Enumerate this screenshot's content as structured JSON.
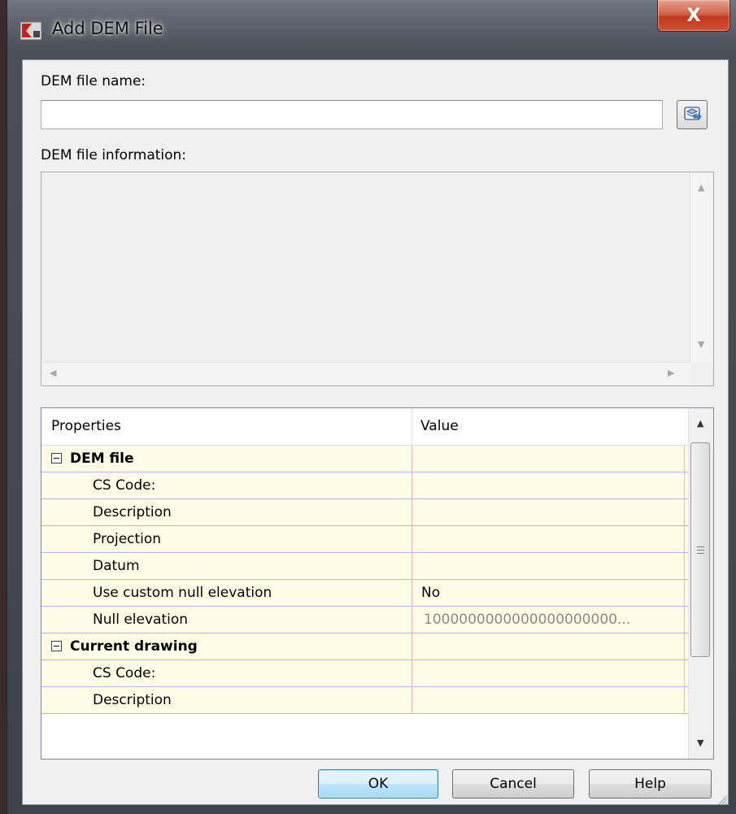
{
  "window": {
    "title": "Add DEM File",
    "close_label": "X",
    "app_icon": "autocad-map-icon",
    "close_color": "#c0391f"
  },
  "filename": {
    "label": "DEM file name:",
    "value": "",
    "placeholder": "",
    "browse_icon": "folder-browse-icon"
  },
  "info": {
    "label": "DEM file information:"
  },
  "grid": {
    "columns": [
      "Properties",
      "Value"
    ],
    "rows": [
      {
        "type": "group",
        "label": "DEM file",
        "value": ""
      },
      {
        "type": "item",
        "label": "CS Code:",
        "value": ""
      },
      {
        "type": "item",
        "label": "Description",
        "value": ""
      },
      {
        "type": "item",
        "label": "Projection",
        "value": ""
      },
      {
        "type": "item",
        "label": "Datum",
        "value": ""
      },
      {
        "type": "item",
        "label": "Use custom null elevation",
        "value": "No"
      },
      {
        "type": "item",
        "label": "Null elevation",
        "value": "1000000000000000000000...",
        "disabled": true
      },
      {
        "type": "group",
        "label": "Current drawing",
        "value": ""
      },
      {
        "type": "item",
        "label": "CS Code:",
        "value": ""
      },
      {
        "type": "item",
        "label": "Description",
        "value": ""
      }
    ],
    "row_bg": "#fffde6",
    "grid_line_color": "#b7b6f4"
  },
  "buttons": {
    "ok": "OK",
    "cancel": "Cancel",
    "help": "Help"
  }
}
